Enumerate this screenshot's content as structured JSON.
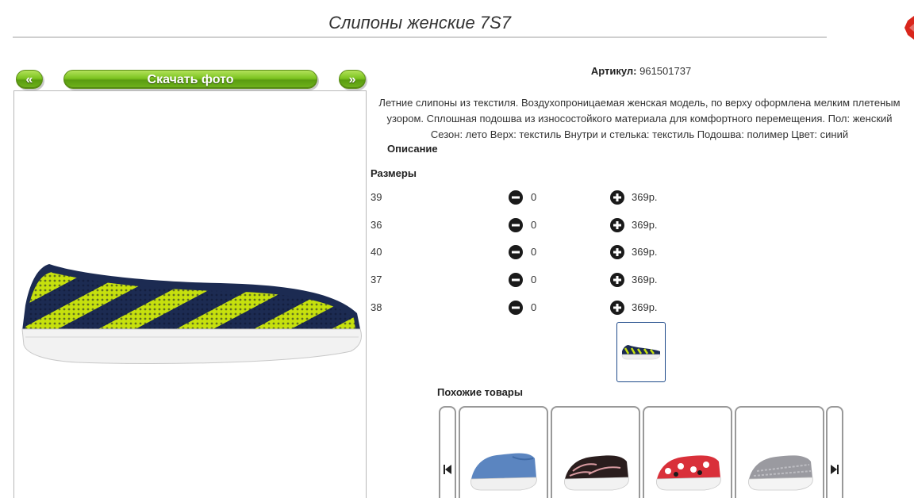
{
  "product": {
    "title": "Слипоны женские 7S7",
    "article_label": "Артикул:",
    "article_value": "961501737",
    "description": "Летние слипоны из текстиля. Воздухопроницаемая женская модель, по верху оформлена мелким плетеным узором. Сплошная подошва из износостойкого материала для комфортного перемещения. Пол: женский Сезон: лето Верх: текстиль Внутри и стелька: текстиль Подошва: полимер Цвет: синий",
    "description_heading": "Описание"
  },
  "gallery": {
    "prev_label": "«",
    "download_label": "Скачать фото",
    "next_label": "»"
  },
  "sizes": {
    "heading": "Размеры",
    "rows": [
      {
        "size": "39",
        "qty": "0",
        "price": "369р."
      },
      {
        "size": "36",
        "qty": "0",
        "price": "369р."
      },
      {
        "size": "40",
        "qty": "0",
        "price": "369р."
      },
      {
        "size": "37",
        "qty": "0",
        "price": "369р."
      },
      {
        "size": "38",
        "qty": "0",
        "price": "369р."
      }
    ]
  },
  "similar": {
    "heading": "Похожие товары",
    "items": [
      {
        "icon": "blue-slipon-image"
      },
      {
        "icon": "lace-slipon-image"
      },
      {
        "icon": "red-pattern-slipon-image"
      },
      {
        "icon": "grey-slipon-image"
      }
    ]
  },
  "colors": {
    "accent_green": "#7cc420",
    "thumb_border": "#1f4a8a",
    "shoe_navy": "#1c2b52",
    "shoe_yellow": "#c6e00e"
  }
}
